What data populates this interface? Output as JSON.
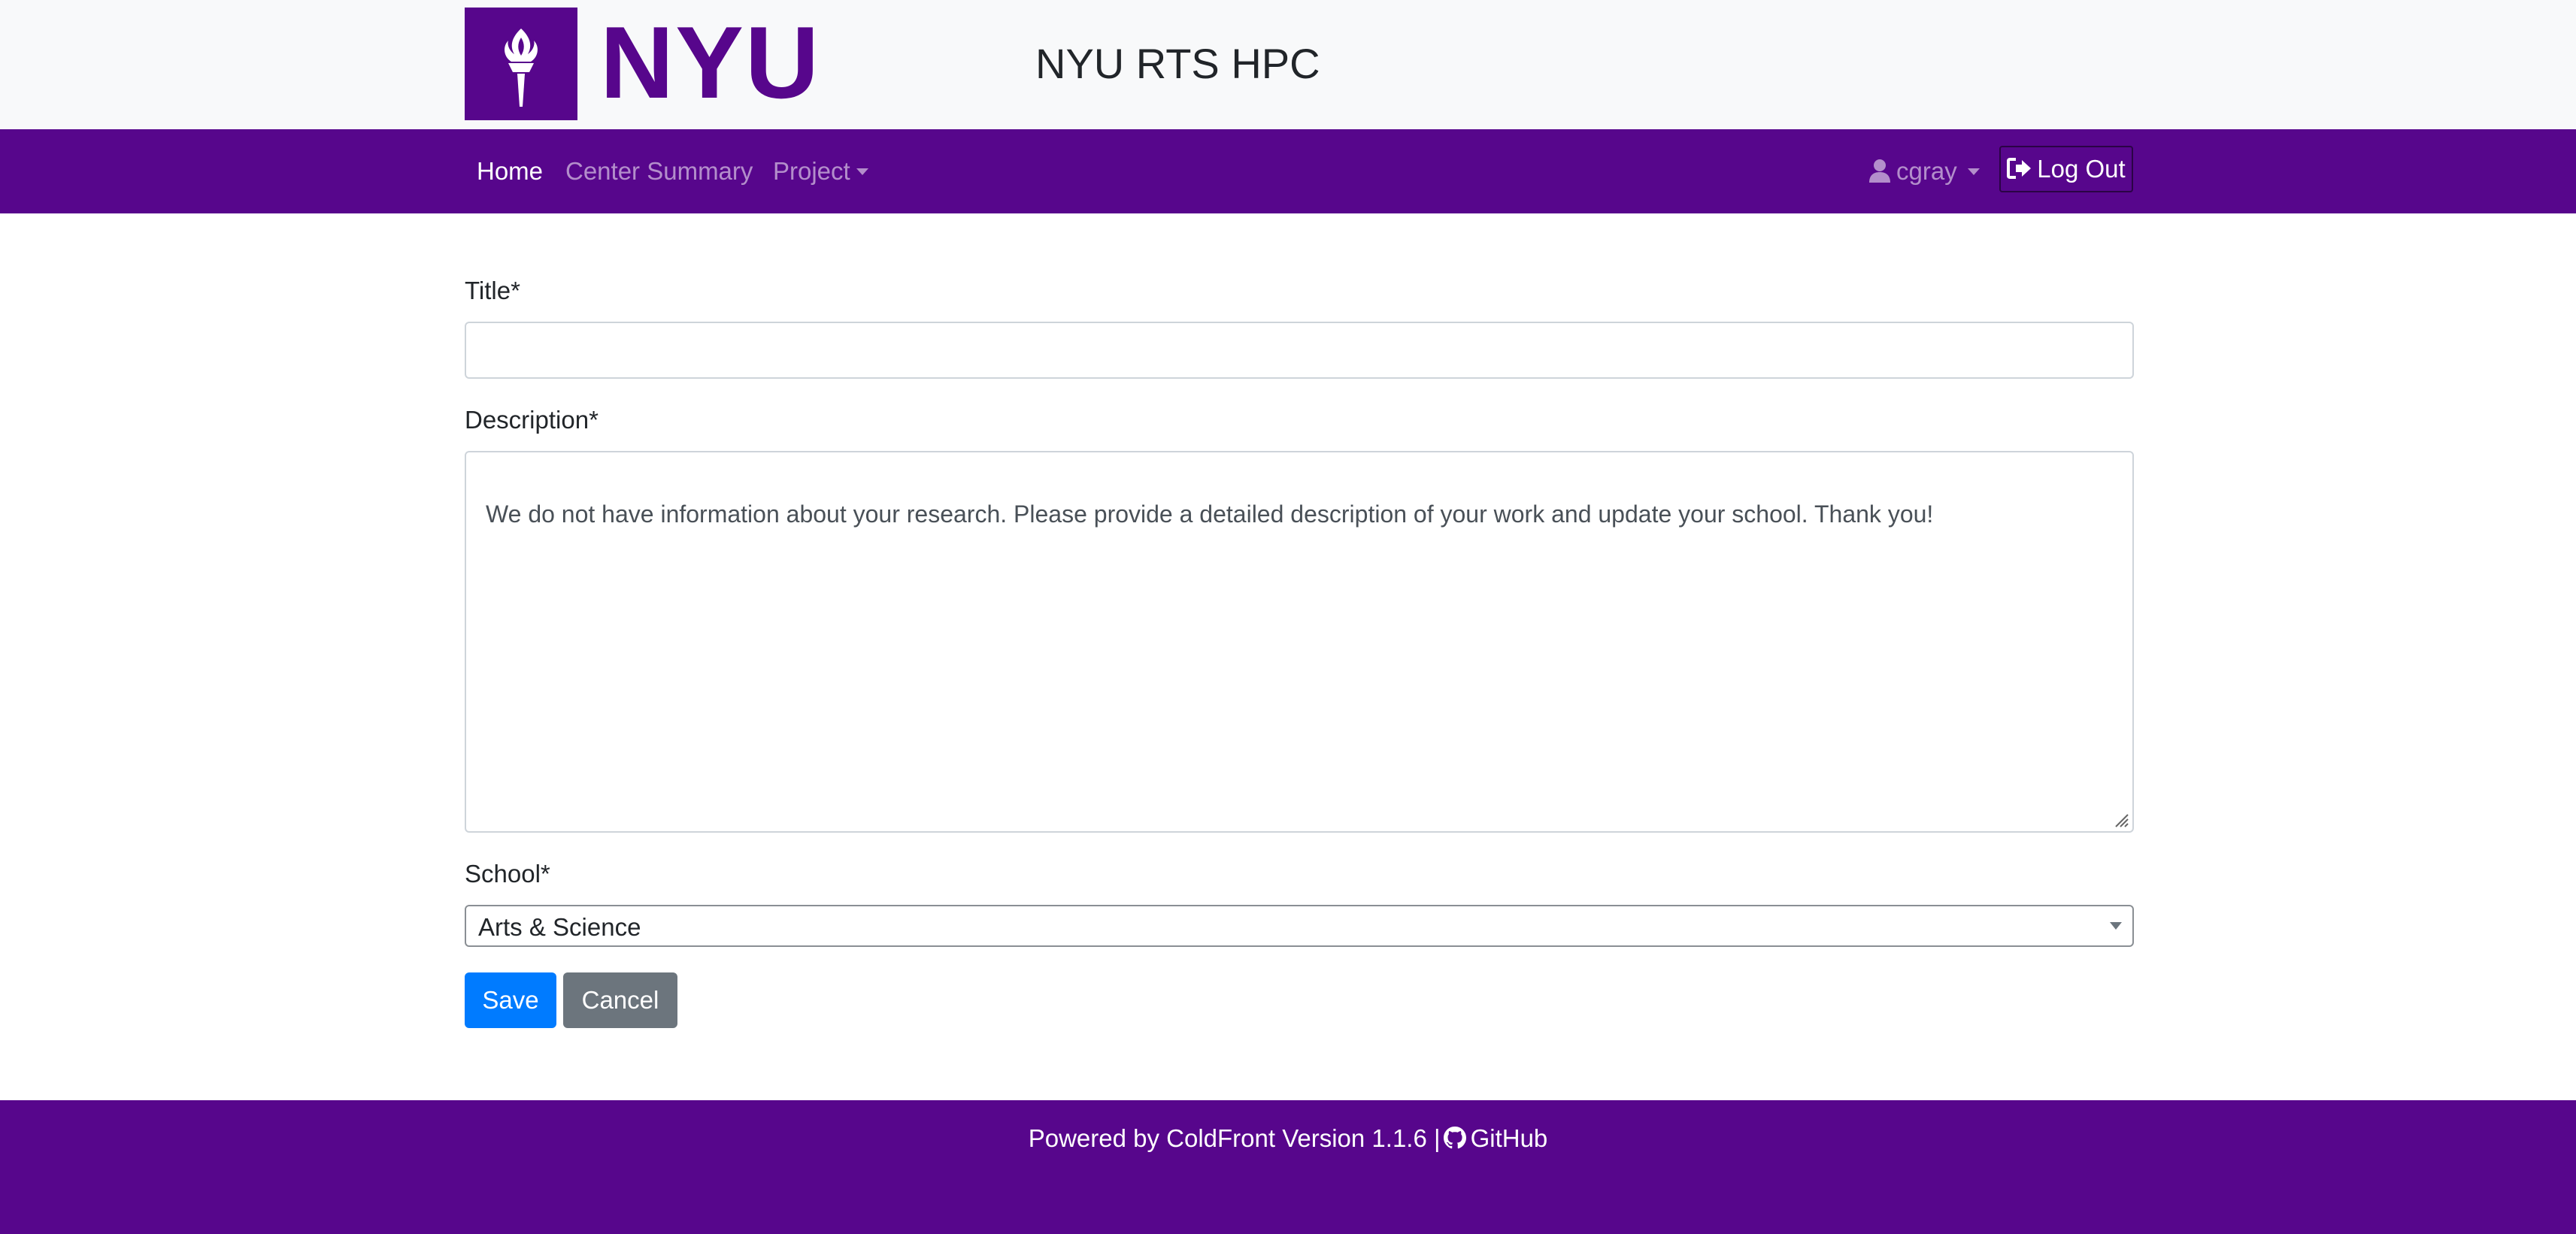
{
  "header": {
    "logo_text": "NYU",
    "site_title": "NYU RTS HPC"
  },
  "nav": {
    "items": [
      {
        "label": "Home",
        "active": true
      },
      {
        "label": "Center Summary",
        "active": false
      },
      {
        "label": "Project",
        "active": false,
        "dropdown": true
      }
    ],
    "user": {
      "label": "cgray",
      "icon": "user-icon"
    },
    "logout": {
      "label": "Log Out",
      "icon": "sign-out-icon"
    }
  },
  "form": {
    "title_label": "Title*",
    "title_value": "",
    "description_label": "Description*",
    "description_value": "We do not have information about your research. Please provide a detailed description of your work and update your school. Thank you!",
    "school_label": "School*",
    "school_value": "Arts & Science",
    "save_label": "Save",
    "cancel_label": "Cancel"
  },
  "footer": {
    "powered_by": "Powered by ColdFront Version 1.1.6 |",
    "github_label": "GitHub",
    "github_icon": "github-icon"
  },
  "colors": {
    "brand": "#57068c",
    "primary": "#007bff",
    "secondary": "#6c757d",
    "header_bg": "#f8f9fa"
  }
}
